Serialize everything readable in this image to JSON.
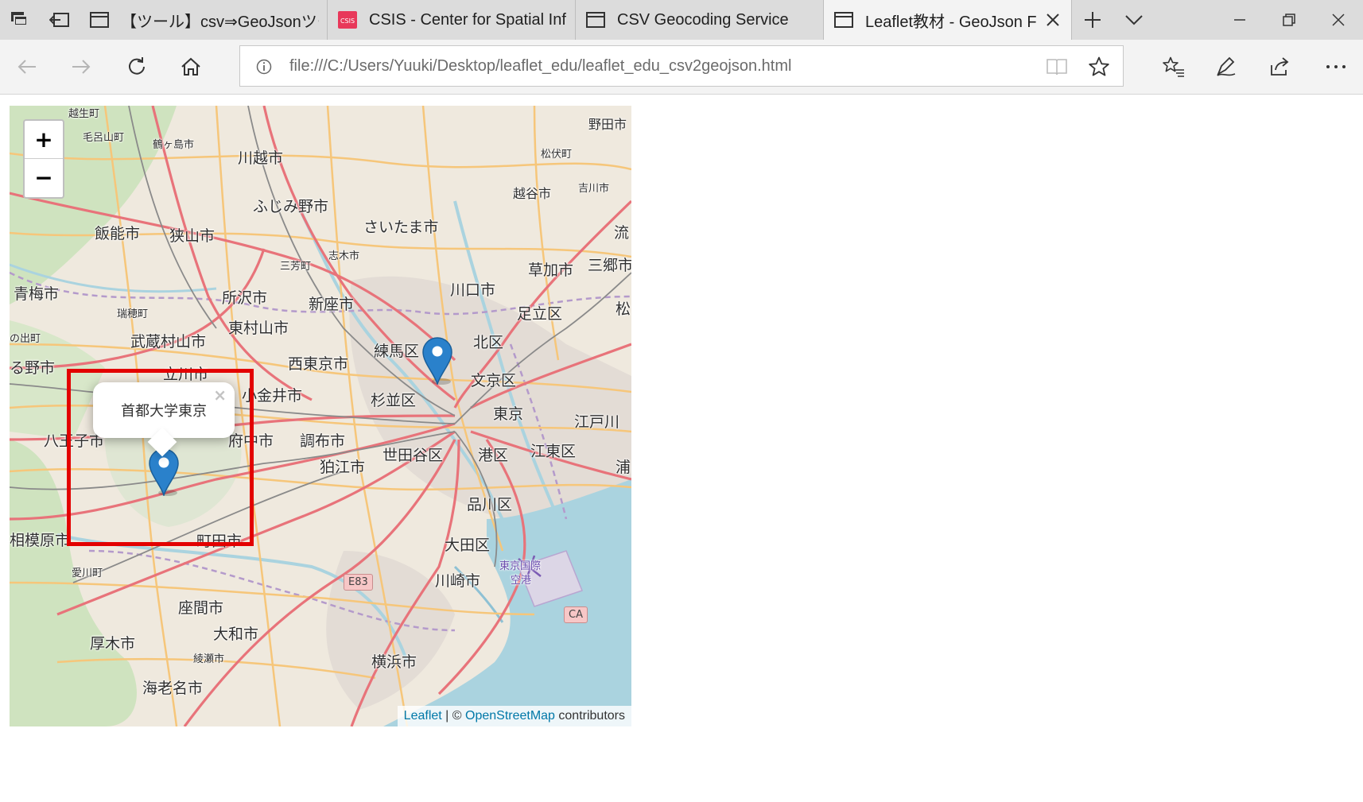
{
  "browser": {
    "tabs": [
      {
        "title": "【ツール】csv⇒GeoJsonツール |",
        "favicon": "page-icon",
        "active": false
      },
      {
        "title": "CSIS - Center for Spatial Inf",
        "favicon": "csis-logo",
        "favicon_text": "CSIS",
        "active": false
      },
      {
        "title": "CSV Geocoding Service",
        "favicon": "page-icon",
        "active": false
      },
      {
        "title": "Leaflet教材 - GeoJson F",
        "favicon": "page-icon",
        "active": true
      }
    ],
    "address_url": "file:///C:/Users/Yuuki/Desktop/leaflet_edu/leaflet_edu_csv2geojson.html"
  },
  "map": {
    "zoom_in_label": "+",
    "zoom_out_label": "−",
    "popup_text": "首都大学東京",
    "popup_close": "×",
    "attribution": {
      "leaflet": "Leaflet",
      "separator": " | © ",
      "osm": "OpenStreetMap",
      "suffix": " contributors"
    },
    "place_labels": [
      "越生町",
      "毛呂山町",
      "鶴ヶ島市",
      "川越市",
      "野田市",
      "松伏町",
      "吉川市",
      "越谷市",
      "ふじみ野市",
      "飯能市",
      "狭山市",
      "さいたま市",
      "流",
      "三芳町",
      "志木市",
      "草加市",
      "三郷市",
      "青梅市",
      "所沢市",
      "新座市",
      "川口市",
      "松",
      "瑞穂町",
      "東村山市",
      "足立区",
      "の出町",
      "武蔵村山市",
      "練馬区",
      "北区",
      "る野市",
      "立川市",
      "西東京市",
      "文京区",
      "小金井市",
      "杉並区",
      "東京",
      "江戸川",
      "八王子市",
      "府中市",
      "調布市",
      "世田谷区",
      "江東区",
      "狛江市",
      "港区",
      "浦",
      "品川区",
      "相模原市",
      "町田市",
      "大田区",
      "東京国際",
      "空港",
      "愛川町",
      "川崎市",
      "座間市",
      "大和市",
      "厚木市",
      "綾瀬市",
      "横浜市",
      "海老名市"
    ],
    "road_signs": [
      "E83",
      "CA"
    ],
    "colors": {
      "marker": "#2a81cb",
      "highlight": "#e30000",
      "water": "#aad3df",
      "road_major": "#e8737a",
      "road_secondary": "#f6c67a"
    }
  }
}
